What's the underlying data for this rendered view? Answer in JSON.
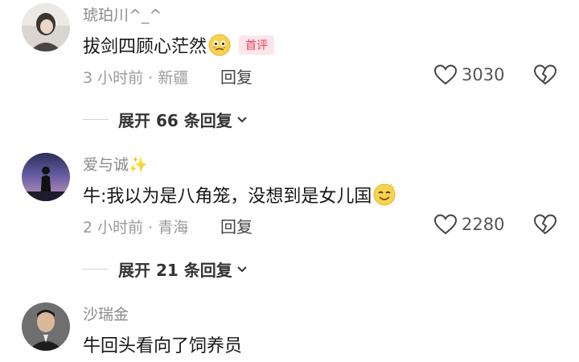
{
  "comments": [
    {
      "username": "琥珀川^_^",
      "text": "拔剑四顾心茫然",
      "emoji": "worried-face-emoji",
      "badge": "首评",
      "meta": "3 小时前 · 新疆",
      "reply_label": "回复",
      "likes": "3030",
      "expand_label": "展开 66 条回复"
    },
    {
      "username": "爱与诚✨",
      "text": "牛:我以为是八角笼，没想到是女儿国",
      "emoji": "smiling-face-emoji",
      "meta": "2 小时前 · 青海",
      "reply_label": "回复",
      "likes": "2280",
      "expand_label": "展开 21 条回复"
    },
    {
      "username": "沙瑞金",
      "text": "牛回头看向了饲养员"
    }
  ],
  "icons": {
    "like": "heart-outline-icon",
    "dislike": "broken-heart-icon",
    "expand": "chevron-down-icon"
  },
  "colors": {
    "badge_text": "#f23a5a",
    "badge_bg": "#fde6ea",
    "username": "#8a8a8a",
    "content": "#161616"
  }
}
